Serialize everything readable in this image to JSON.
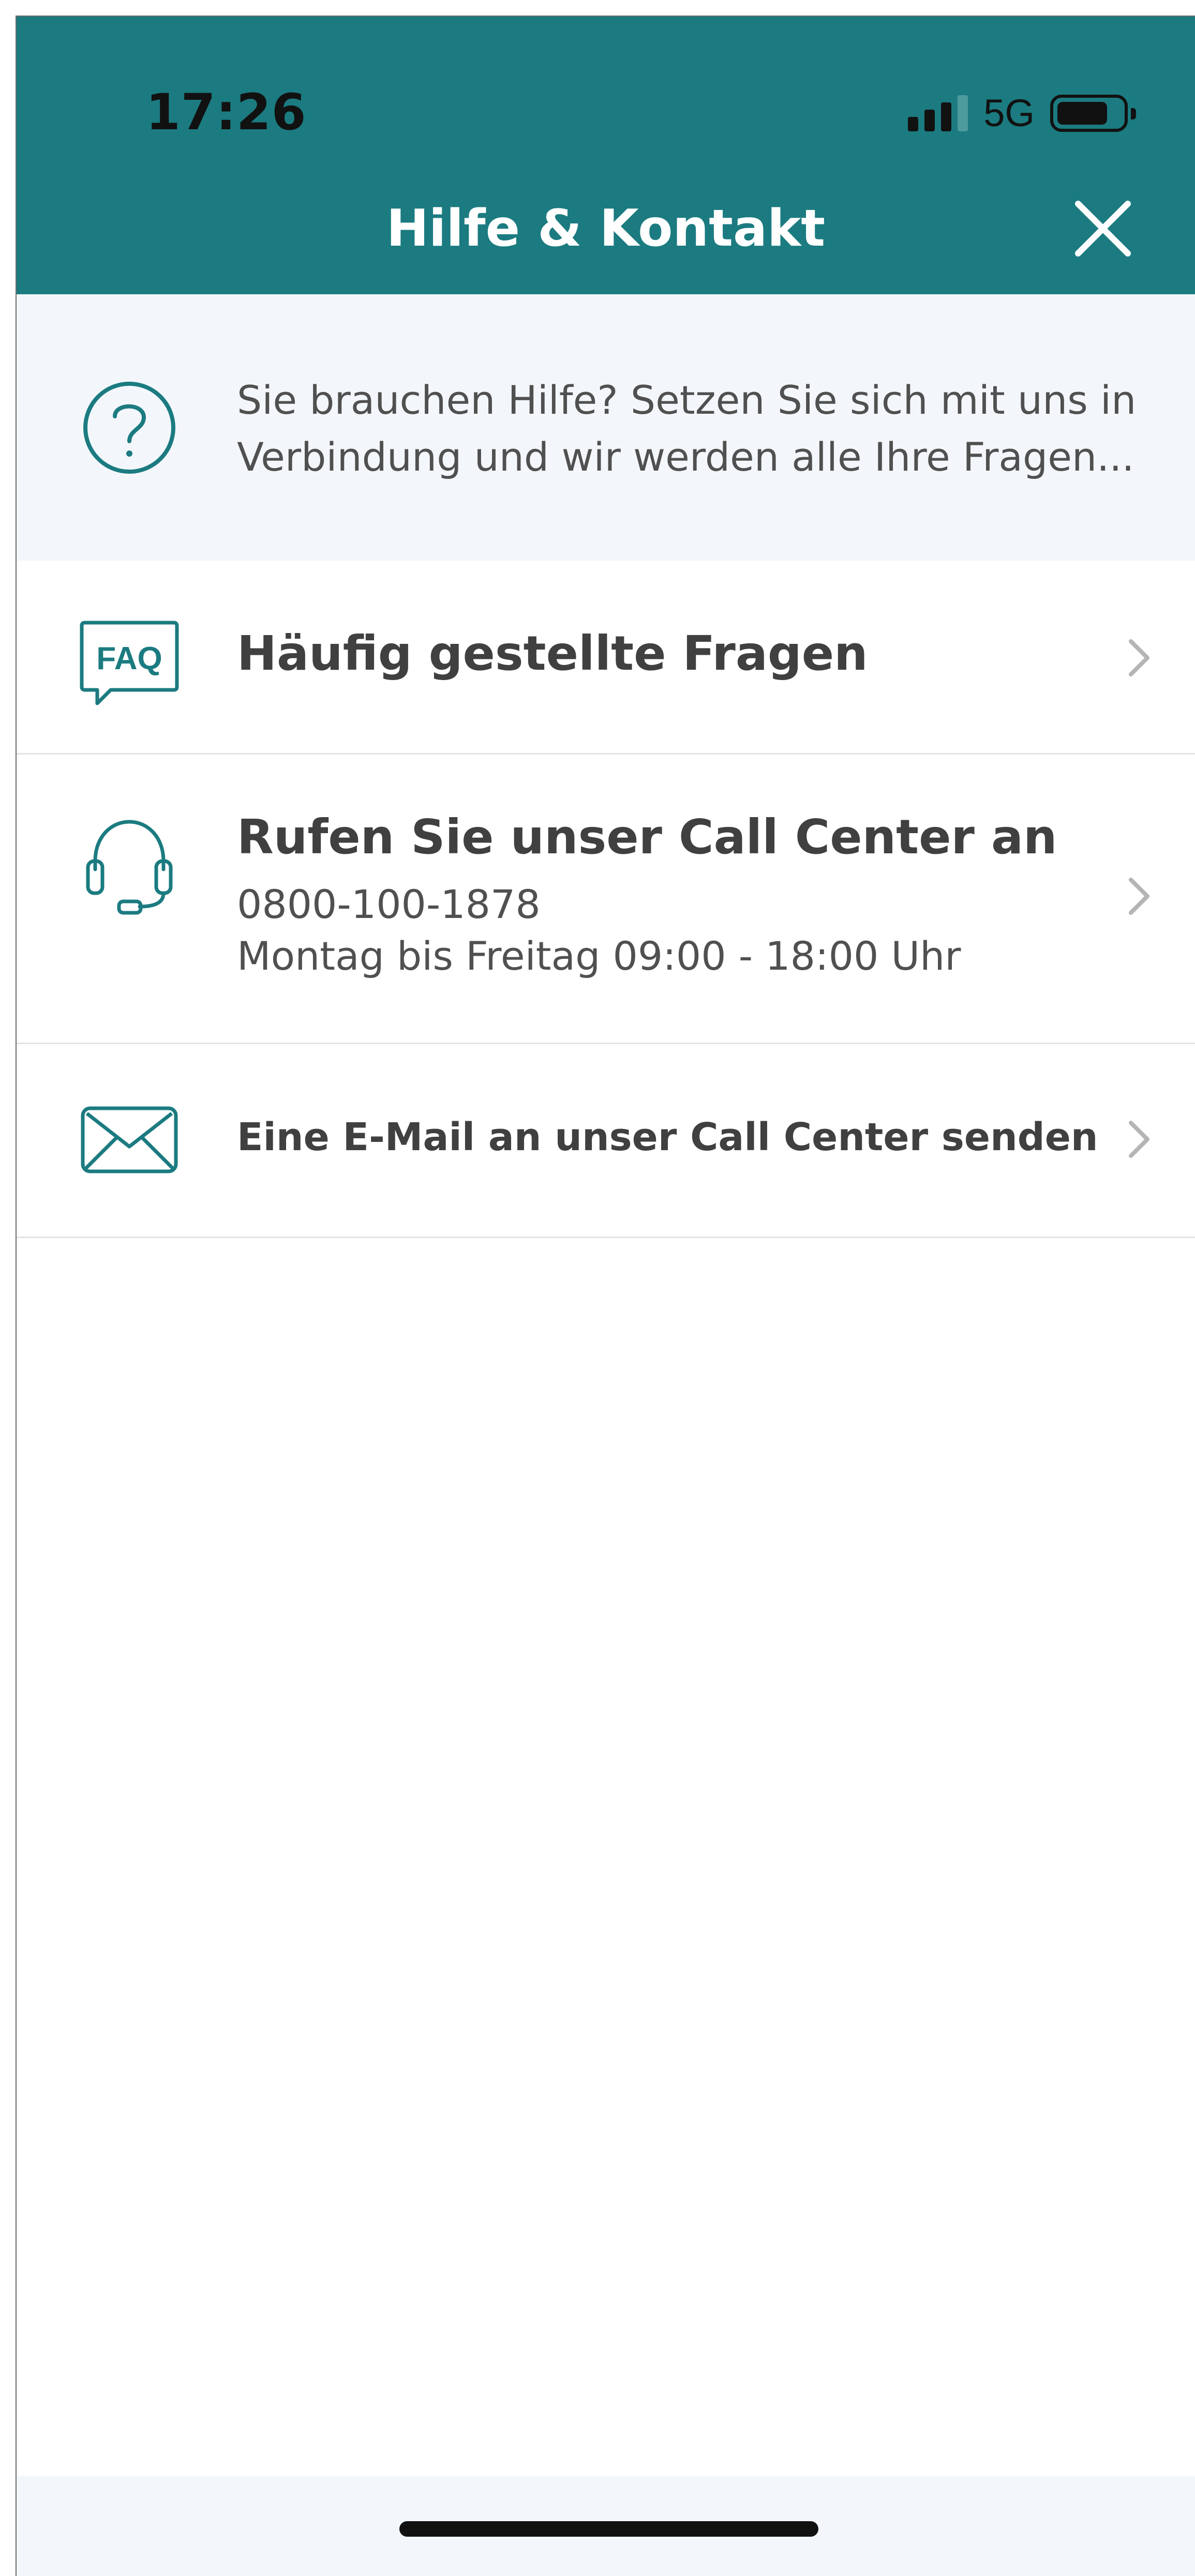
{
  "status_bar": {
    "time": "17:26",
    "network": "5G",
    "icons": [
      "signal-icon",
      "battery-icon"
    ]
  },
  "header": {
    "title": "Hilfe & Kontakt",
    "close_icon": "close-icon",
    "background_color": "#1b7b80"
  },
  "info": {
    "icon": "question-circle-icon",
    "text_line1": "Sie brauchen Hilfe? Setzen Sie sich mit uns in",
    "text_line2": "Verbindung und wir werden alle Ihre Fragen..."
  },
  "items": [
    {
      "icon": "faq-icon",
      "icon_label": "FAQ",
      "title": "Häufig gestellte Fragen"
    },
    {
      "icon": "headset-icon",
      "title": "Rufen Sie unser Call Center an",
      "phone": "0800-100-1878",
      "hours": "Montag bis Freitag 09:00 - 18:00 Uhr"
    },
    {
      "icon": "mail-icon",
      "title": "Eine E-Mail an unser Call Center senden"
    }
  ],
  "colors": {
    "accent": "#1b7b80",
    "text": "#404040",
    "banner_bg": "#f3f7fc",
    "divider": "#e3e3e3"
  }
}
